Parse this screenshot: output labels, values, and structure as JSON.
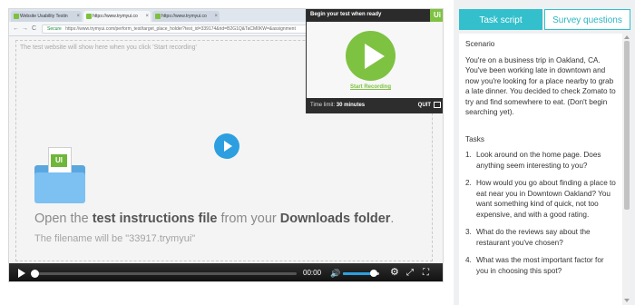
{
  "browser": {
    "tabs": [
      {
        "label": "Website Usability Testin"
      },
      {
        "label": "https://www.trymyui.co"
      },
      {
        "label": "https://www.trymyui.co"
      }
    ],
    "address_secure": "Secure",
    "address_url": "https://www.trymyui.com/perform_test/target_place_holder?test_id=339174&rid=B2G1Q&TaCM0KW=&assignment",
    "nav": {
      "back": "←",
      "forward": "→",
      "reload": "C"
    }
  },
  "test_page": {
    "placeholder": "The test website will show here when you click 'Start recording'",
    "instruction_pre": "Open the ",
    "instruction_b1": "test instructions file",
    "instruction_mid": " from your ",
    "instruction_b2": "Downloads folder",
    "instruction_end": ".",
    "filename": "The filename will be \"33917.trymyui\"",
    "folder_badge": "UI"
  },
  "recorder": {
    "title": "Begin your test when ready",
    "logo": "Ui",
    "start_label": "Start Recording",
    "time_limit_prefix": "Time limit: ",
    "time_limit_value": "30 minutes",
    "quit_label": "QUIT"
  },
  "video_controls": {
    "time": "00:00",
    "progress": 0.0,
    "volume": 0.85,
    "icons": {
      "volume": "🔊",
      "settings": "⚙",
      "fullscreen": "⤢",
      "expand": "⛶"
    }
  },
  "panel": {
    "tab_active": "Task script",
    "tab_inactive": "Survey questions",
    "scenario_heading": "Scenario",
    "scenario_text": "You're on a business trip in Oakland, CA. You've been working late in downtown and now you're looking for a place nearby to grab a late dinner. You decided to check Zomato to try and find somewhere to eat. (Don't begin searching yet).",
    "tasks_heading": "Tasks",
    "tasks": [
      {
        "num": "1.",
        "text": "Look around on the home page. Does anything seem interesting to you?"
      },
      {
        "num": "2.",
        "text": "How would you go about finding a place to eat near you in Downtown Oakland? You want something kind of quick, not too expensive, and with a good rating."
      },
      {
        "num": "3.",
        "text": "What do the reviews say about the restaurant you've chosen?"
      },
      {
        "num": "4.",
        "text": "What was the most important factor for you in choosing this spot?"
      }
    ]
  },
  "colors": {
    "accent": "#33bfcc",
    "record_green": "#7ec242",
    "video_play": "#2d9fe0"
  }
}
